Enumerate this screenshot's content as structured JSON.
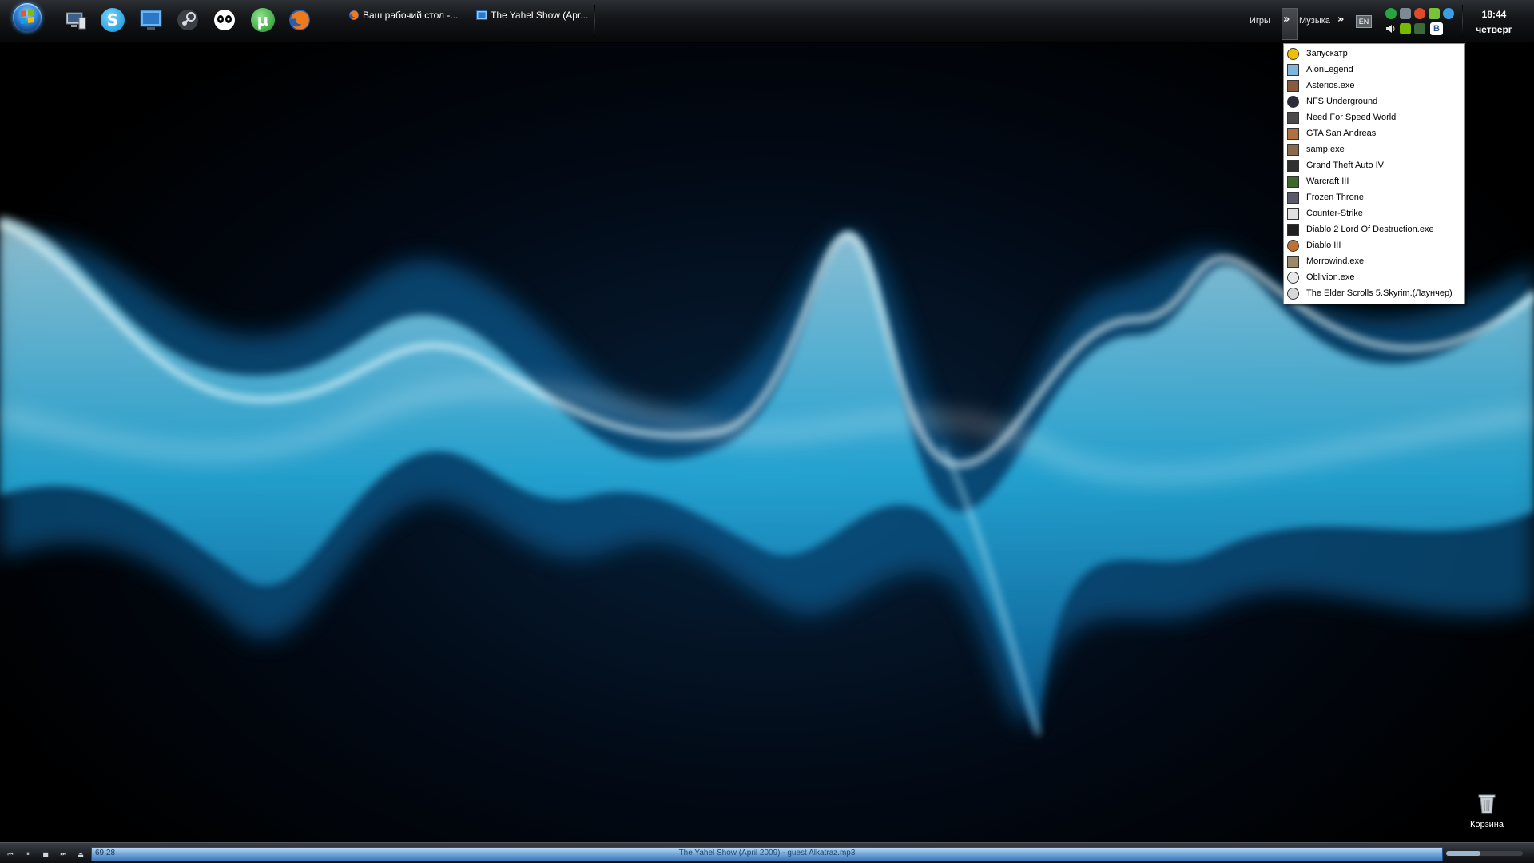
{
  "taskbar": {
    "quick_launch": [
      {
        "name": "my-computer-icon"
      },
      {
        "name": "skype-icon",
        "glyph": "S",
        "color": "#1fa3e6"
      },
      {
        "name": "mail-ru-agent-icon",
        "glyph": "@",
        "color": "#3b7fd0"
      },
      {
        "name": "steam-icon",
        "glyph": "⚙",
        "color": "#5a5f66"
      },
      {
        "name": "panda-icon",
        "glyph": "•• ",
        "color": "#ffffff"
      },
      {
        "name": "utorrent-icon",
        "glyph": "µ",
        "color": "#2fa13a"
      },
      {
        "name": "firefox-icon",
        "glyph": "",
        "color": "#e8671c"
      }
    ],
    "tasks": [
      {
        "label": "Ваш рабочий стол -...",
        "icon": "firefox-icon"
      },
      {
        "label": "The Yahel Show (Apr...",
        "icon": "media-player-icon"
      }
    ],
    "toolbars": {
      "games": "Игры",
      "music": "Музыка",
      "chevron": "»"
    },
    "tray": {
      "language": "EN",
      "icons": [
        "whatsapp-icon",
        "network-icon",
        "antivirus-icon",
        "update-icon",
        "messenger-icon",
        "volume-icon",
        "nvidia-icon",
        "vk-icon"
      ],
      "vk_glyph": "B"
    },
    "clock": {
      "time": "18:44",
      "day": "четверг"
    }
  },
  "games_menu": {
    "items": [
      {
        "label": "Запускатр",
        "icon_color": "#f0c000"
      },
      {
        "label": "AionLegend",
        "icon_color": "#7fb6e0"
      },
      {
        "label": "Asterios.exe",
        "icon_color": "#8a5a3a"
      },
      {
        "label": "NFS Underground",
        "icon_color": "#2a2a3a"
      },
      {
        "label": "Need For Speed World",
        "icon_color": "#4a4a4a"
      },
      {
        "label": "GTA San Andreas",
        "icon_color": "#b07040"
      },
      {
        "label": "samp.exe",
        "icon_color": "#8a6a4a"
      },
      {
        "label": "Grand Theft Auto IV",
        "icon_color": "#303030"
      },
      {
        "label": "Warcraft III",
        "icon_color": "#3a6a2a"
      },
      {
        "label": "Frozen Throne",
        "icon_color": "#5a5a6a"
      },
      {
        "label": "Counter-Strike",
        "icon_color": "#e0e0e0"
      },
      {
        "label": "Diablo 2 Lord Of Destruction.exe",
        "icon_color": "#202020"
      },
      {
        "label": "Diablo III",
        "icon_color": "#c07030"
      },
      {
        "label": "Morrowind.exe",
        "icon_color": "#9a8a6a"
      },
      {
        "label": "Oblivion.exe",
        "icon_color": "#e8e8e8"
      },
      {
        "label": "The Elder Scrolls 5.Skyrim.(Лаунчер)",
        "icon_color": "#d8d8d8"
      }
    ]
  },
  "desktop": {
    "recycle_bin_label": "Корзина"
  },
  "media_bar": {
    "elapsed": "69:28",
    "track_title": "The Yahel Show (April 2009) - guest Alkatraz.mp3",
    "volume": 0.45,
    "controls": [
      "previous-icon",
      "pause-icon",
      "stop-icon",
      "next-icon",
      "eject-icon"
    ]
  },
  "colors": {
    "taskbar_bg": "#131518",
    "menu_bg": "#ffffff",
    "accent_wave": "#3fd2ff"
  }
}
